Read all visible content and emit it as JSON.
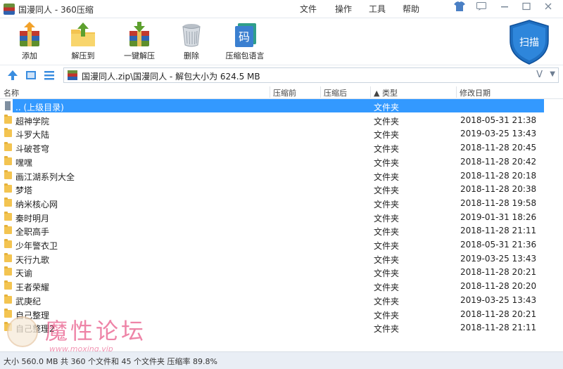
{
  "window": {
    "title": "国漫同人 - 360压缩",
    "menus": [
      "文件",
      "操作",
      "工具",
      "帮助"
    ]
  },
  "toolbar": {
    "add": "添加",
    "extract_to": "解压到",
    "one_click_extract": "一键解压",
    "delete": "删除",
    "language": "压缩包语言",
    "scan": "扫描"
  },
  "address": {
    "path": "国漫同人.zip\\国漫同人 - 解包大小为 624.5 MB",
    "v_label": "V"
  },
  "columns": {
    "name": "名称",
    "compressed": "压缩前",
    "after": "压缩后",
    "type": "▲ 类型",
    "modified": "修改日期"
  },
  "files": [
    {
      "name": ".. (上级目录)",
      "type": "文件夹",
      "date": ""
    },
    {
      "name": "超神学院",
      "type": "文件夹",
      "date": "2018-05-31 21:38"
    },
    {
      "name": "斗罗大陆",
      "type": "文件夹",
      "date": "2019-03-25 13:43"
    },
    {
      "name": "斗破苍穹",
      "type": "文件夹",
      "date": "2018-11-28 20:45"
    },
    {
      "name": "嘿嘿",
      "type": "文件夹",
      "date": "2018-11-28 20:42"
    },
    {
      "name": "画江湖系列大全",
      "type": "文件夹",
      "date": "2018-11-28 20:18"
    },
    {
      "name": "梦塔",
      "type": "文件夹",
      "date": "2018-11-28 20:38"
    },
    {
      "name": "纳米核心网",
      "type": "文件夹",
      "date": "2018-11-28 19:58"
    },
    {
      "name": "秦时明月",
      "type": "文件夹",
      "date": "2019-01-31 18:26"
    },
    {
      "name": "全职高手",
      "type": "文件夹",
      "date": "2018-11-28 21:11"
    },
    {
      "name": "少年警衣卫",
      "type": "文件夹",
      "date": "2018-05-31 21:36"
    },
    {
      "name": "天行九歌",
      "type": "文件夹",
      "date": "2019-03-25 13:43"
    },
    {
      "name": "天谕",
      "type": "文件夹",
      "date": "2018-11-28 20:21"
    },
    {
      "name": "王者荣耀",
      "type": "文件夹",
      "date": "2018-11-28 20:20"
    },
    {
      "name": "武庚纪",
      "type": "文件夹",
      "date": "2019-03-25 13:43"
    },
    {
      "name": "自己整理",
      "type": "文件夹",
      "date": "2018-11-28 20:21"
    },
    {
      "name": "自己整理2",
      "type": "文件夹",
      "date": "2018-11-28 21:11"
    }
  ],
  "watermark": {
    "text": "魔性论坛",
    "url": "www.moxing.vip"
  },
  "status": "大小 560.0 MB 共 360 个文件和 45 个文件夹 压缩率 89.8%",
  "colors": {
    "selection": "#3399ff",
    "folder": "#f3c451",
    "shield": "#1f6fc1",
    "statusbar": "#e9eef5"
  }
}
